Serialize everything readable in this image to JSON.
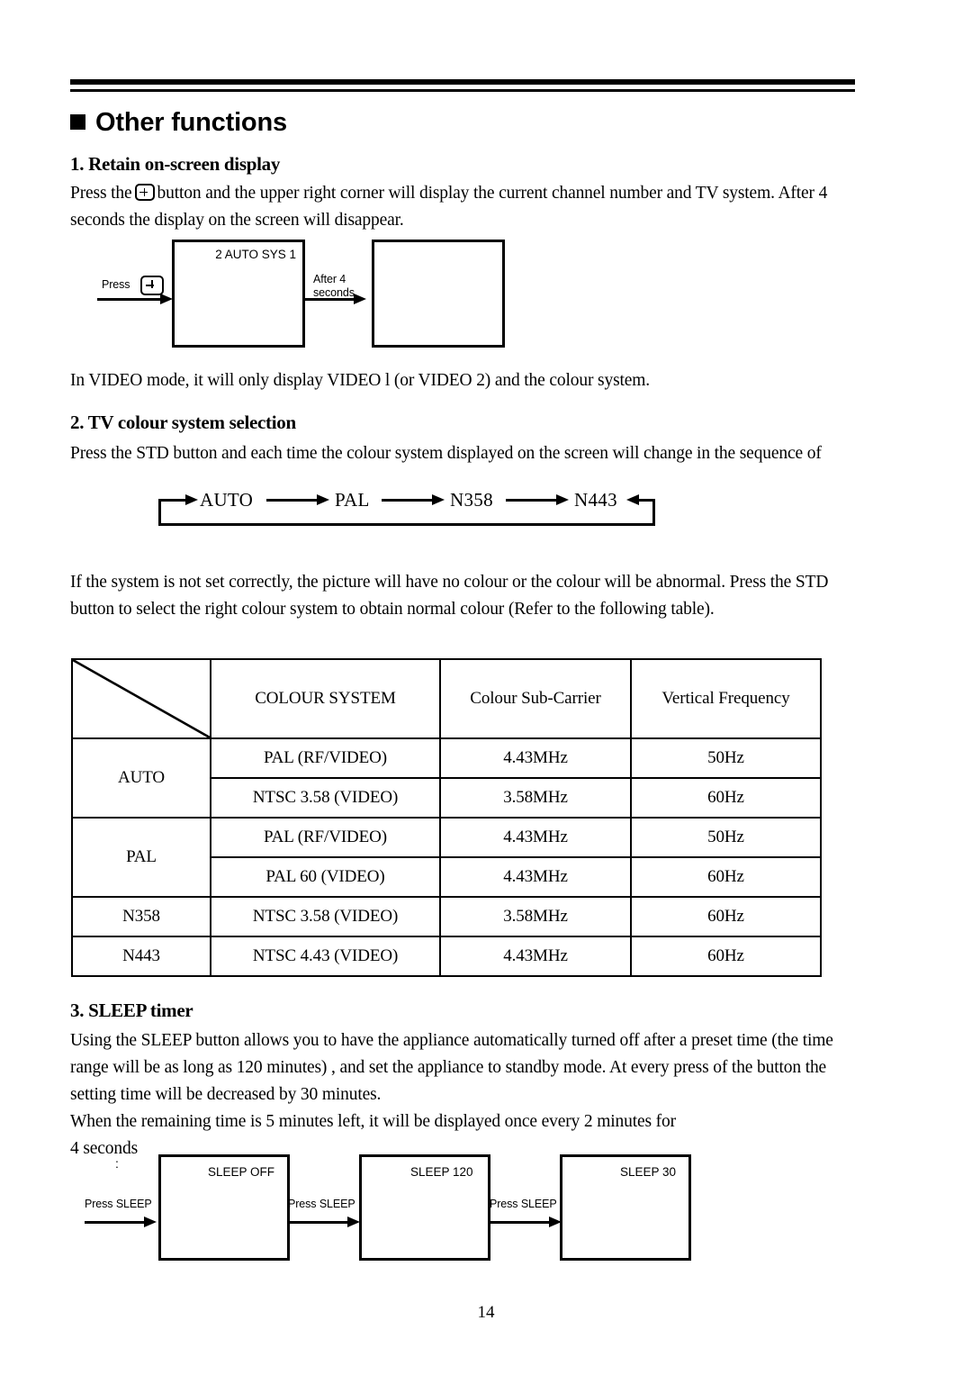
{
  "document": {
    "page_number": "14",
    "section_title": "Other functions"
  },
  "sections": [
    {
      "heading": "1. Retain on-screen display",
      "body_before_icon": "Press the",
      "icon": "plus-key-icon",
      "body_after_icon": "button and the upper right corner will display the current channel number and TV system. After 4 seconds the display on the screen will disappear.",
      "note": "In VIDEO mode, it will only display VIDEO l (or VIDEO 2) and the colour system."
    },
    {
      "heading": "2. TV colour system selection",
      "body": "Press the STD button and each time the colour system displayed on the screen will change in the sequence of",
      "body2": "If the system is not set correctly, the picture will have no colour or the colour will be abnormal. Press the STD button to select the right colour system to obtain normal colour (Refer to the following table)."
    },
    {
      "heading": "3. SLEEP timer",
      "body": "Using the SLEEP button allows you to have the appliance automatically turned off after a preset time (the time range will be as long as 120 minutes) , and set the appliance to standby mode. At every press of the button the setting time will be decreased by 30 minutes.\nWhen the remaining  time is 5 minutes left, it will be displayed once every 2 minutes for\n4 seconds"
    }
  ],
  "osd_diagram": {
    "press_label": "Press",
    "key_icon": "plus-key-icon",
    "screen1_lines": "2\nAUTO\nSYS 1",
    "transition_label": "After 4\nseconds",
    "screen2_lines": ""
  },
  "sequence_diagram": {
    "items": [
      "AUTO",
      "PAL",
      "N358",
      "N443"
    ],
    "loop": true
  },
  "table": {
    "corner_cell": "",
    "headers": [
      "COLOUR SYSTEM",
      "Colour Sub-Carrier",
      "Vertical Frequency"
    ],
    "rows": [
      {
        "mode": "AUTO",
        "entries": [
          {
            "system": "PAL (RF/VIDEO)",
            "sub_carrier": "4.43MHz",
            "vertical_frequency": "50Hz"
          },
          {
            "system": "NTSC 3.58 (VIDEO)",
            "sub_carrier": "3.58MHz",
            "vertical_frequency": "60Hz"
          }
        ]
      },
      {
        "mode": "PAL",
        "entries": [
          {
            "system": "PAL (RF/VIDEO)",
            "sub_carrier": "4.43MHz",
            "vertical_frequency": "50Hz"
          },
          {
            "system": "PAL 60 (VIDEO)",
            "sub_carrier": "4.43MHz",
            "vertical_frequency": "60Hz"
          }
        ]
      },
      {
        "mode": "N358",
        "entries": [
          {
            "system": "NTSC 3.58 (VIDEO)",
            "sub_carrier": "3.58MHz",
            "vertical_frequency": "60Hz"
          }
        ]
      },
      {
        "mode": "N443",
        "entries": [
          {
            "system": "NTSC 4.43 (VIDEO)",
            "sub_carrier": "4.43MHz",
            "vertical_frequency": "60Hz"
          }
        ]
      }
    ]
  },
  "sleep_diagram": {
    "dots": ":",
    "arrow_labels": [
      "Press SLEEP",
      "Press SLEEP",
      "Press SLEEP"
    ],
    "boxes": [
      "SLEEP OFF",
      "SLEEP 120",
      "SLEEP 30"
    ]
  }
}
